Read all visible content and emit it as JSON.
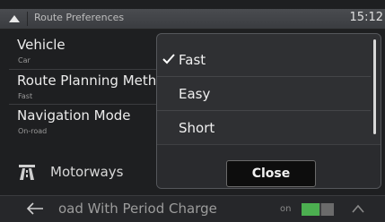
{
  "header": {
    "title": "Route Preferences",
    "clock": "15:12"
  },
  "prefs": [
    {
      "label": "Vehicle",
      "value": "Car"
    },
    {
      "label": "Route Planning Meth",
      "value": "Fast"
    },
    {
      "label": "Navigation Mode",
      "value": "On-road"
    }
  ],
  "motorways": {
    "label": "Motorways"
  },
  "bottom": {
    "label": "oad With Period Charge",
    "toggle_text": "on",
    "toggle_state": "on"
  },
  "popup": {
    "options": [
      {
        "label": "Fast",
        "checked": true
      },
      {
        "label": "Easy",
        "checked": false
      },
      {
        "label": "Short",
        "checked": false
      }
    ],
    "close_label": "Close"
  },
  "icons": {
    "back": "back-arrow-icon",
    "motorway": "motorway-icon",
    "check": "checkmark-icon",
    "up": "chevron-up-icon"
  }
}
